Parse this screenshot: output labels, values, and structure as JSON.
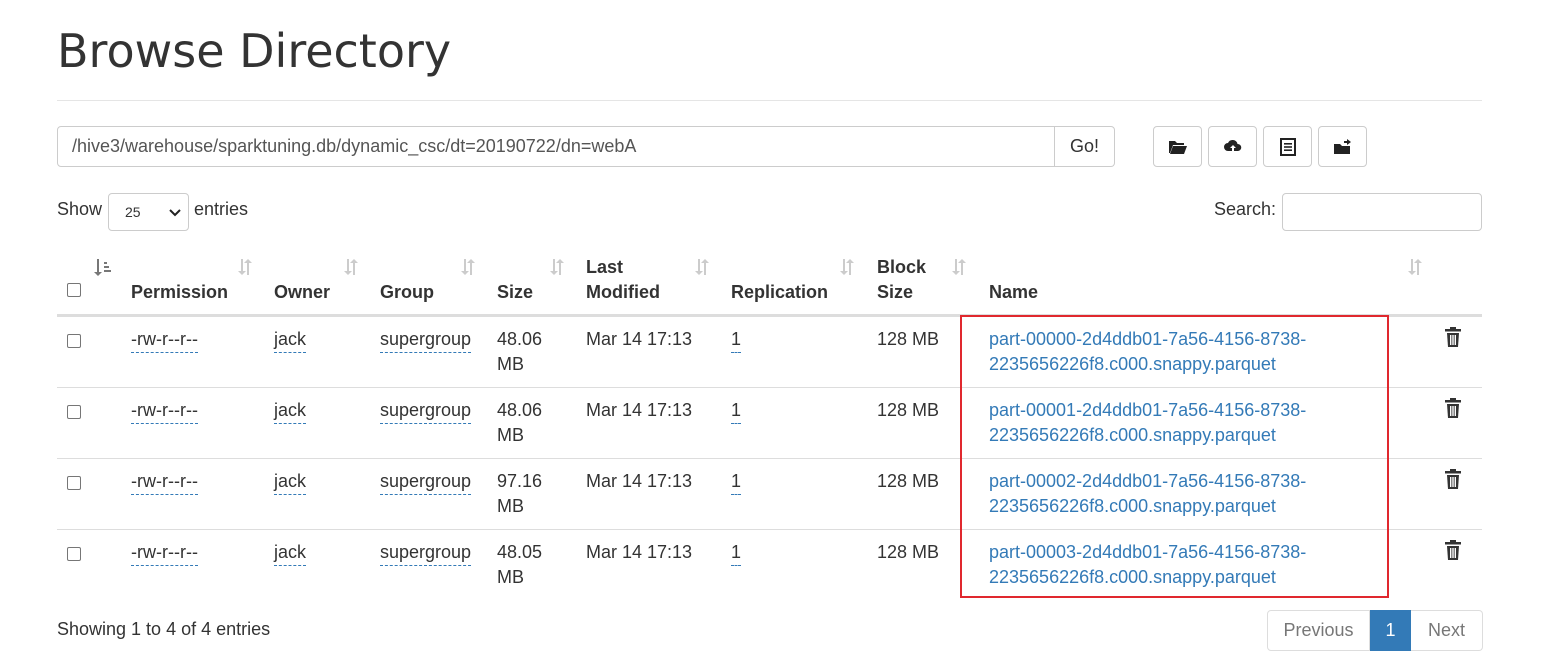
{
  "page": {
    "title": "Browse Directory"
  },
  "pathbar": {
    "path": "/hive3/warehouse/sparktuning.db/dynamic_csc/dt=20190722/dn=webA",
    "go_label": "Go!",
    "tools": [
      {
        "icon": "folder-open-icon"
      },
      {
        "icon": "cloud-upload-icon"
      },
      {
        "icon": "list-icon"
      },
      {
        "icon": "new-folder-icon"
      }
    ]
  },
  "length": {
    "show_label": "Show",
    "value": "25",
    "entries_label": "entries"
  },
  "search": {
    "label": "Search:",
    "value": ""
  },
  "table": {
    "headers": {
      "permission": "Permission",
      "owner": "Owner",
      "group": "Group",
      "size": "Size",
      "modified_1": "Last",
      "modified_2": "Modified",
      "replication": "Replication",
      "block_1": "Block",
      "block_2": "Size",
      "name": "Name"
    },
    "rows": [
      {
        "permission": "-rw-r--r--",
        "owner": "jack",
        "group": "supergroup",
        "size_1": "48.06",
        "size_2": "MB",
        "modified": "Mar 14 17:13",
        "replication": "1",
        "block": "128 MB",
        "name_1": "part-00000-2d4ddb01-7a56-4156-8738-",
        "name_2": "2235656226f8.c000.snappy.parquet"
      },
      {
        "permission": "-rw-r--r--",
        "owner": "jack",
        "group": "supergroup",
        "size_1": "48.06",
        "size_2": "MB",
        "modified": "Mar 14 17:13",
        "replication": "1",
        "block": "128 MB",
        "name_1": "part-00001-2d4ddb01-7a56-4156-8738-",
        "name_2": "2235656226f8.c000.snappy.parquet"
      },
      {
        "permission": "-rw-r--r--",
        "owner": "jack",
        "group": "supergroup",
        "size_1": "97.16",
        "size_2": "MB",
        "modified": "Mar 14 17:13",
        "replication": "1",
        "block": "128 MB",
        "name_1": "part-00002-2d4ddb01-7a56-4156-8738-",
        "name_2": "2235656226f8.c000.snappy.parquet"
      },
      {
        "permission": "-rw-r--r--",
        "owner": "jack",
        "group": "supergroup",
        "size_1": "48.05",
        "size_2": "MB",
        "modified": "Mar 14 17:13",
        "replication": "1",
        "block": "128 MB",
        "name_1": "part-00003-2d4ddb01-7a56-4156-8738-",
        "name_2": "2235656226f8.c000.snappy.parquet"
      }
    ]
  },
  "footer": {
    "info": "Showing 1 to 4 of 4 entries",
    "prev": "Previous",
    "current": "1",
    "next": "Next"
  },
  "colors": {
    "link": "#337ab7",
    "highlight": "#e0282e",
    "active_page": "#337ab7"
  }
}
